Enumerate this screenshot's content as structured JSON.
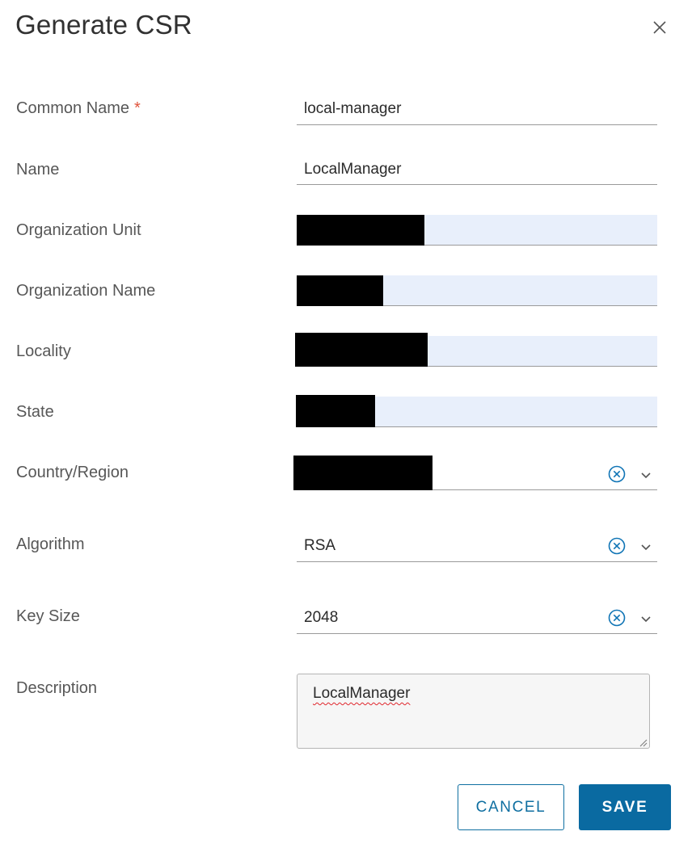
{
  "dialog": {
    "title": "Generate CSR",
    "close_icon": "close-icon"
  },
  "form": {
    "common_name": {
      "label": "Common Name",
      "required_mark": "*",
      "value": "local-manager"
    },
    "name": {
      "label": "Name",
      "value": "LocalManager"
    },
    "organization_unit": {
      "label": "Organization Unit",
      "value_redacted": true
    },
    "organization_name": {
      "label": "Organization Name",
      "value_redacted": true
    },
    "locality": {
      "label": "Locality",
      "value_redacted": true
    },
    "state": {
      "label": "State",
      "value_redacted": true
    },
    "country_region": {
      "label": "Country/Region",
      "value_redacted": true,
      "clear_icon": "clear-circle-icon",
      "dropdown_icon": "chevron-down-icon"
    },
    "algorithm": {
      "label": "Algorithm",
      "value": "RSA",
      "clear_icon": "clear-circle-icon",
      "dropdown_icon": "chevron-down-icon"
    },
    "key_size": {
      "label": "Key Size",
      "value": "2048",
      "clear_icon": "clear-circle-icon",
      "dropdown_icon": "chevron-down-icon"
    },
    "description": {
      "label": "Description",
      "value": "LocalManager"
    }
  },
  "actions": {
    "cancel_label": "CANCEL",
    "save_label": "SAVE"
  },
  "colors": {
    "accent": "#0a6aa1",
    "required": "#e0533b",
    "autofill_bg": "#e8effb",
    "icon_blue": "#0f74b5"
  }
}
